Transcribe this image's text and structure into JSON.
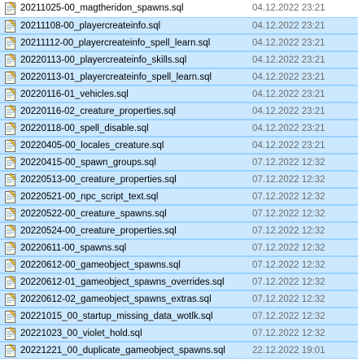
{
  "accent_color": "#cce8ff",
  "selection_border_color": "#99d1ff",
  "file_icon": "sql-file-icon",
  "files": [
    {
      "name": "20211025-00_magtheridon_spawns.sql",
      "modified": "04.12.2022 23:21",
      "selected": false
    },
    {
      "name": "20211108-00_playercreateinfo.sql",
      "modified": "04.12.2022 23:21",
      "selected": true
    },
    {
      "name": "20211112-00_playercreateinfo_spell_learn.sql",
      "modified": "04.12.2022 23:21",
      "selected": true
    },
    {
      "name": "20220113-00_playercreateinfo_skills.sql",
      "modified": "04.12.2022 23:21",
      "selected": true
    },
    {
      "name": "20220113-01_playercreateinfo_spell_learn.sql",
      "modified": "04.12.2022 23:21",
      "selected": true
    },
    {
      "name": "20220116-01_vehicles.sql",
      "modified": "04.12.2022 23:21",
      "selected": true
    },
    {
      "name": "20220116-02_creature_properties.sql",
      "modified": "04.12.2022 23:21",
      "selected": true
    },
    {
      "name": "20220118-00_spell_disable.sql",
      "modified": "04.12.2022 23:21",
      "selected": true
    },
    {
      "name": "20220405-00_locales_creature.sql",
      "modified": "04.12.2022 23:21",
      "selected": true
    },
    {
      "name": "20220415-00_spawn_groups.sql",
      "modified": "07.12.2022 12:32",
      "selected": true
    },
    {
      "name": "20220513-00_creature_properties.sql",
      "modified": "07.12.2022 12:32",
      "selected": true
    },
    {
      "name": "20220521-00_npc_script_text.sql",
      "modified": "07.12.2022 12:32",
      "selected": true
    },
    {
      "name": "20220522-00_creature_spawns.sql",
      "modified": "07.12.2022 12:32",
      "selected": true
    },
    {
      "name": "20220524-00_creature_properties.sql",
      "modified": "07.12.2022 12:32",
      "selected": true
    },
    {
      "name": "20220611-00_spawns.sql",
      "modified": "07.12.2022 12:32",
      "selected": true
    },
    {
      "name": "20220612-00_gameobject_spawns.sql",
      "modified": "07.12.2022 12:32",
      "selected": true
    },
    {
      "name": "20220612-01_gameobject_spawns_overrides.sql",
      "modified": "07.12.2022 12:32",
      "selected": true
    },
    {
      "name": "20220612-02_gameobject_spawns_extras.sql",
      "modified": "07.12.2022 12:32",
      "selected": true
    },
    {
      "name": "20221015_00_startup_missing_data_wotlk.sql",
      "modified": "07.12.2022 12:32",
      "selected": true
    },
    {
      "name": "20221023_00_violet_hold.sql",
      "modified": "07.12.2022 12:32",
      "selected": true
    },
    {
      "name": "20221221_00_duplicate_gameobject_spawns.sql",
      "modified": "22.12.2022 19:01",
      "selected": true
    }
  ]
}
